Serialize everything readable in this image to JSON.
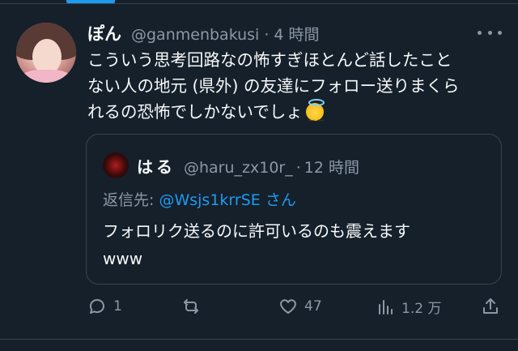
{
  "tweet": {
    "author_name": "ぽん",
    "author_handle": "@ganmenbakusi",
    "separator": "·",
    "timestamp": "4 時間",
    "text_lines": [
      "こういう思考回路なの怖すぎほとんど話したこと",
      "ない人の地元 (県外) の友達にフォロー送りまくら",
      "れるの恐怖でしかないでしょ"
    ],
    "emoji": "smiling-face-with-halo"
  },
  "quote": {
    "author_name": "はる",
    "author_handle": "@haru_zx10r_",
    "separator": "·",
    "timestamp": "12 時間",
    "reply_prefix": "返信先:",
    "reply_mention": "@Wsjs1krrSE",
    "reply_suffix": "さん",
    "text_lines": [
      "フォロリク送るのに許可いるのも震えます",
      "www"
    ]
  },
  "actions": {
    "reply_count": "1",
    "retweet_count": "",
    "like_count": "47",
    "view_count": "1.2 万"
  },
  "colors": {
    "background": "#15202b",
    "text": "#f7f9f9",
    "muted": "#8b98a5",
    "accent": "#1d9bf0",
    "border": "#38444d"
  }
}
